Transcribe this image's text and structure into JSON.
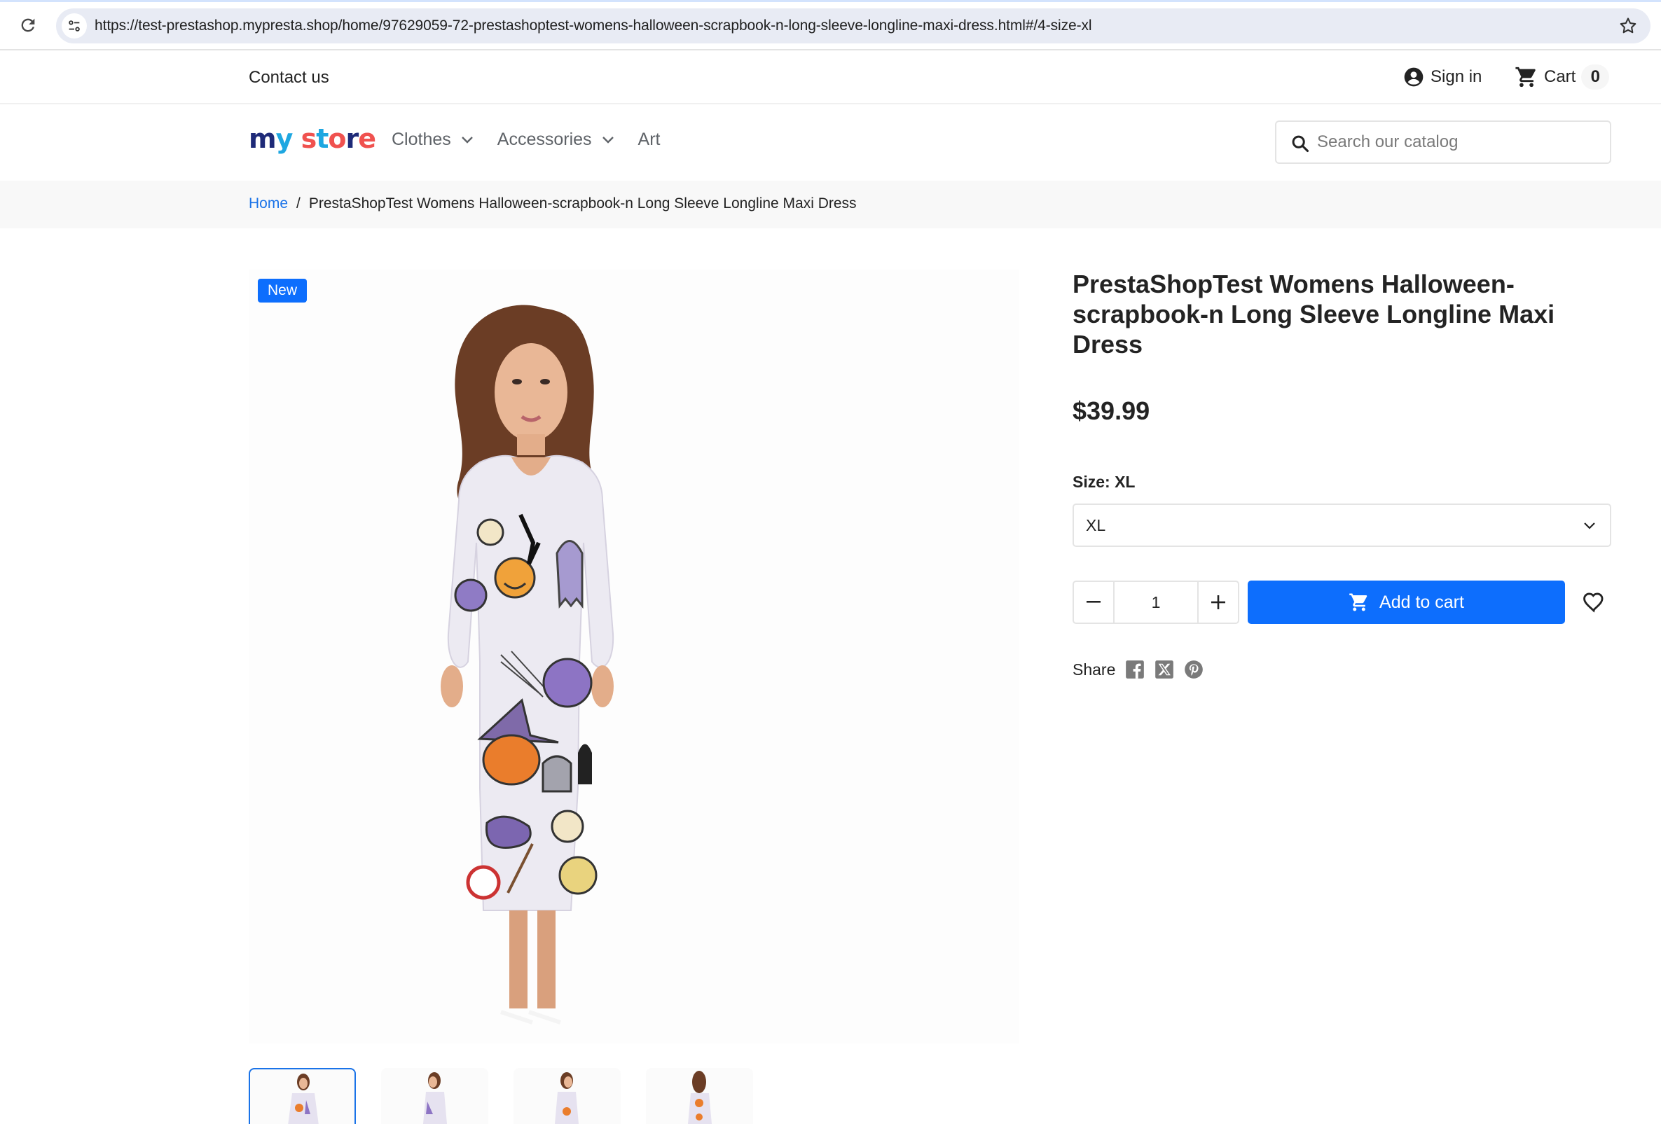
{
  "browser": {
    "url": "https://test-prestashop.mypresta.shop/home/97629059-72-prestashoptest-womens-halloween-scrapbook-n-long-sleeve-longline-maxi-dress.html#/4-size-xl"
  },
  "header": {
    "contact_label": "Contact us",
    "signin_label": "Sign in",
    "cart_label": "Cart",
    "cart_count": "0",
    "logo_letters": [
      "m",
      "y",
      " ",
      "s",
      "t",
      "o",
      "r",
      "e"
    ],
    "logo_text": "my store",
    "nav": [
      {
        "label": "Clothes",
        "has_dropdown": true
      },
      {
        "label": "Accessories",
        "has_dropdown": true
      },
      {
        "label": "Art",
        "has_dropdown": false
      }
    ],
    "search_placeholder": "Search our catalog"
  },
  "breadcrumb": {
    "home_label": "Home",
    "separator": "/",
    "current": "PrestaShopTest Womens Halloween-scrapbook-n Long Sleeve Longline Maxi Dress"
  },
  "product": {
    "badge": "New",
    "title": "PrestaShopTest Womens Halloween-scrapbook-n Long Sleeve Longline Maxi Dress",
    "price": "$39.99",
    "size_label": "Size: XL",
    "size_selected": "XL",
    "quantity": "1",
    "add_to_cart_label": "Add to cart",
    "share_label": "Share",
    "share_networks": [
      "facebook",
      "x",
      "pinterest"
    ],
    "image_alt": "Woman wearing white long sleeve maxi dress with Halloween doodle print",
    "thumbnails": [
      {
        "view": "front",
        "active": true
      },
      {
        "view": "side-left",
        "active": false
      },
      {
        "view": "side-right",
        "active": false
      },
      {
        "view": "back",
        "active": false
      }
    ]
  },
  "colors": {
    "accent": "#0d6efd",
    "link": "#1a73e8",
    "text": "#232323",
    "nav_text": "#5f6368",
    "breadcrumb_bg": "#f8f8f8"
  }
}
